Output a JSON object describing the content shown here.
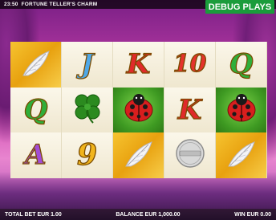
{
  "status_bar": {
    "clock": "23:50",
    "title": "FORTUNE TELLER'S CHARM"
  },
  "debug_badge": "DEBUG PLAYS",
  "reels": [
    [
      {
        "type": "feather-icon",
        "bg": "gold"
      },
      {
        "type": "letter",
        "text": "Q",
        "cls": "l-Q"
      },
      {
        "type": "letter",
        "text": "A",
        "cls": "l-A"
      }
    ],
    [
      {
        "type": "letter",
        "text": "J",
        "cls": "l-J"
      },
      {
        "type": "clover-icon",
        "bg": "plain"
      },
      {
        "type": "letter",
        "text": "9",
        "cls": "l-9"
      }
    ],
    [
      {
        "type": "letter",
        "text": "K",
        "cls": "l-K"
      },
      {
        "type": "ladybug-icon",
        "bg": "green"
      },
      {
        "type": "feather-icon",
        "bg": "gold"
      }
    ],
    [
      {
        "type": "letter",
        "text": "10",
        "cls": "l-10"
      },
      {
        "type": "letter",
        "text": "K",
        "cls": "l-K"
      },
      {
        "type": "coin-icon",
        "bg": "plain"
      }
    ],
    [
      {
        "type": "letter",
        "text": "Q",
        "cls": "l-Q"
      },
      {
        "type": "ladybug-icon",
        "bg": "green"
      },
      {
        "type": "feather-icon",
        "bg": "gold"
      }
    ]
  ],
  "bottom_bar": {
    "total_bet": "TOTAL BET EUR 1.00",
    "balance": "BALANCE EUR 1,000.00",
    "win": "WIN EUR 0.00"
  }
}
